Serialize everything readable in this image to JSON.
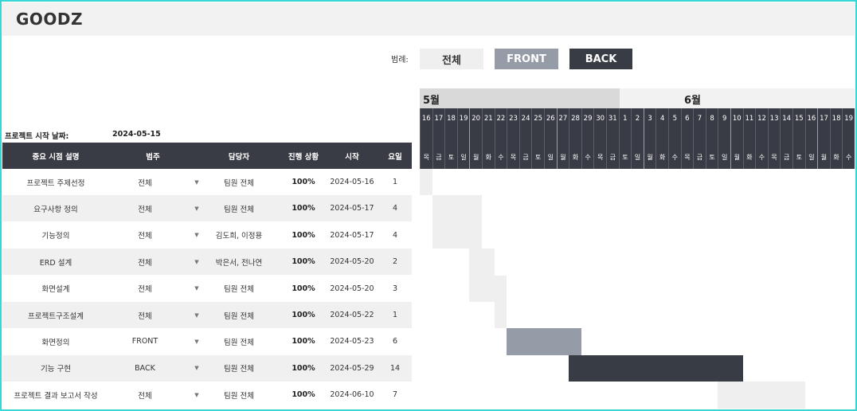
{
  "app": {
    "title": "GOODZ"
  },
  "legend": {
    "label": "범례:",
    "items": [
      {
        "label": "전체",
        "color": "#efefef"
      },
      {
        "label": "FRONT",
        "color": "#959ba7"
      },
      {
        "label": "BACK",
        "color": "#383c44"
      }
    ]
  },
  "project": {
    "start_label": "프로젝트 시작 날짜:",
    "start_value": "2024-05-15"
  },
  "table": {
    "headers": [
      "중요 시점 설명",
      "범주",
      "담당자",
      "진행 상황",
      "시작",
      "요일"
    ],
    "rows": [
      {
        "desc": "프로젝트 주제선정",
        "category": "전체",
        "owner": "팀원 전체",
        "progress": "100%",
        "start": "2024-05-16",
        "days": "1",
        "offset": 1,
        "duration": 1
      },
      {
        "desc": "요구사항 정의",
        "category": "전체",
        "owner": "팀원 전체",
        "progress": "100%",
        "start": "2024-05-17",
        "days": "4",
        "offset": 2,
        "duration": 4
      },
      {
        "desc": "기능정의",
        "category": "전체",
        "owner": "김도희, 이정용",
        "progress": "100%",
        "start": "2024-05-17",
        "days": "4",
        "offset": 2,
        "duration": 4
      },
      {
        "desc": "ERD 설계",
        "category": "전체",
        "owner": "박은서, 전나연",
        "progress": "100%",
        "start": "2024-05-20",
        "days": "2",
        "offset": 5,
        "duration": 2
      },
      {
        "desc": "화면설계",
        "category": "전체",
        "owner": "팀원 전체",
        "progress": "100%",
        "start": "2024-05-20",
        "days": "3",
        "offset": 5,
        "duration": 3
      },
      {
        "desc": "프로젝트구조설계",
        "category": "전체",
        "owner": "팀원 전체",
        "progress": "100%",
        "start": "2024-05-22",
        "days": "1",
        "offset": 7,
        "duration": 1
      },
      {
        "desc": "화면정의",
        "category": "FRONT",
        "owner": "팀원 전체",
        "progress": "100%",
        "start": "2024-05-23",
        "days": "6",
        "offset": 8,
        "duration": 6
      },
      {
        "desc": "기능 구현",
        "category": "BACK",
        "owner": "팀원 전체",
        "progress": "100%",
        "start": "2024-05-29",
        "days": "14",
        "offset": 13,
        "duration": 14
      },
      {
        "desc": "프로젝트 결과 보고서 작성",
        "category": "전체",
        "owner": "팀원 전체",
        "progress": "100%",
        "start": "2024-06-10",
        "days": "7",
        "offset": 25,
        "duration": 7
      }
    ]
  },
  "gantt": {
    "months": [
      {
        "label": "5월"
      },
      {
        "label": "6월"
      }
    ],
    "day_numbers": [
      "16",
      "17",
      "18",
      "19",
      "20",
      "21",
      "22",
      "23",
      "24",
      "25",
      "26",
      "27",
      "28",
      "29",
      "30",
      "31",
      "1",
      "2",
      "3",
      "4",
      "5",
      "6",
      "7",
      "8",
      "9",
      "10",
      "11",
      "12",
      "13",
      "14",
      "15",
      "16",
      "17",
      "18",
      "19"
    ],
    "weekdays": [
      "목",
      "금",
      "토",
      "일",
      "월",
      "화",
      "수",
      "목",
      "금",
      "토",
      "일",
      "월",
      "화",
      "수",
      "목",
      "금",
      "토",
      "일",
      "월",
      "화",
      "수",
      "목",
      "금",
      "토",
      "일",
      "월",
      "화",
      "수",
      "목",
      "금",
      "토",
      "일",
      "월",
      "화",
      "수"
    ],
    "category_colors": {
      "전체": "#efefef",
      "FRONT": "#959ba7",
      "BACK": "#383c44"
    }
  }
}
